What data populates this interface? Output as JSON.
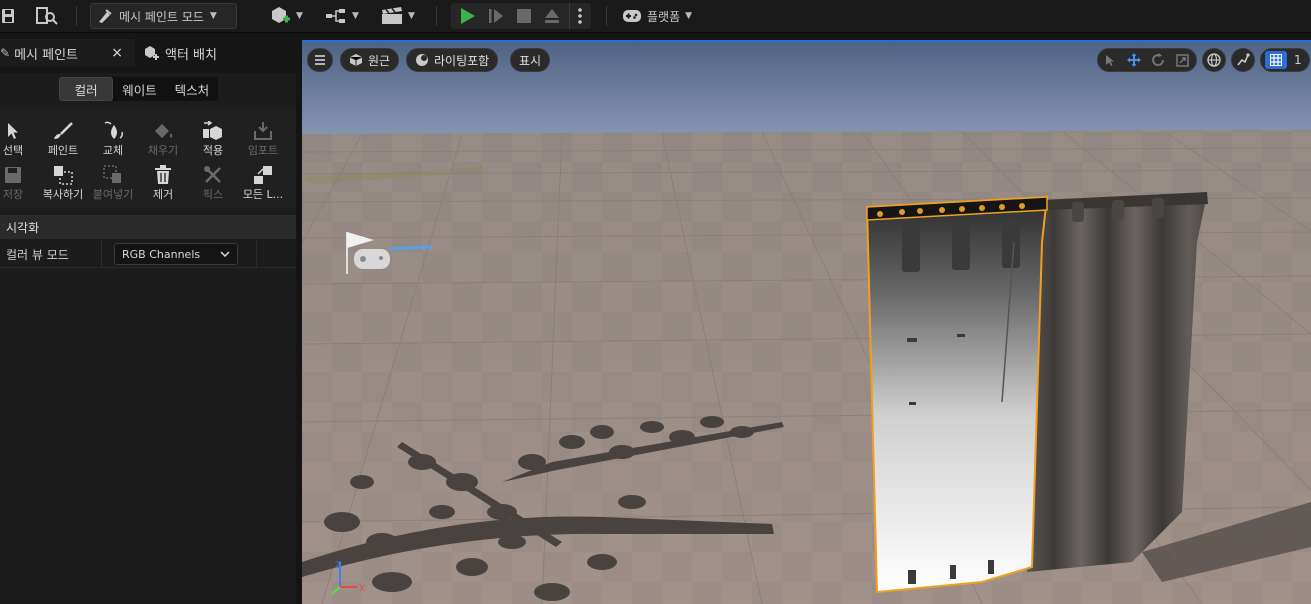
{
  "toolbar": {
    "mode_label": "메시 페인트 모드",
    "platform_label": "플랫폼",
    "icons": [
      "save-icon",
      "browse-icon",
      "mode-icon",
      "add-actor-icon",
      "blueprint-icon",
      "cinematics-icon",
      "play-icon",
      "step-icon",
      "stop-icon",
      "eject-icon",
      "more-icon",
      "platform-icon"
    ]
  },
  "left_panel": {
    "tabs": [
      {
        "label": "메시 페인트",
        "close": "×"
      },
      {
        "label": "액터 배치"
      }
    ],
    "subtabs": [
      "컬러",
      "웨이트",
      "텍스처"
    ],
    "active_subtab": "컬러",
    "tools": [
      {
        "label": "선택",
        "icon": "select-icon",
        "enabled": true
      },
      {
        "label": "페인트",
        "icon": "paint-brush-icon",
        "enabled": true
      },
      {
        "label": "교체",
        "icon": "swap-icon",
        "enabled": true
      },
      {
        "label": "채우기",
        "icon": "fill-icon",
        "enabled": false
      },
      {
        "label": "적용",
        "icon": "apply-icon",
        "enabled": true
      },
      {
        "label": "임포트",
        "icon": "import-icon",
        "enabled": false
      },
      {
        "label": "저장",
        "icon": "save-icon",
        "enabled": false
      },
      {
        "label": "복사하기",
        "icon": "copy-icon",
        "enabled": true
      },
      {
        "label": "붙여넣기",
        "icon": "paste-icon",
        "enabled": false
      },
      {
        "label": "제거",
        "icon": "trash-icon",
        "enabled": true
      },
      {
        "label": "픽스",
        "icon": "fix-icon",
        "enabled": false
      },
      {
        "label": "모든 L...",
        "icon": "lod-icon",
        "enabled": true
      }
    ],
    "section_title": "시각화",
    "properties": [
      {
        "label": "컬러 뷰 모드",
        "value": "RGB Channels"
      }
    ]
  },
  "viewport": {
    "pills": [
      {
        "label": "원근",
        "icon": "perspective-icon"
      },
      {
        "label": "라이팅포함",
        "icon": "lit-icon"
      },
      {
        "label": "표시",
        "icon": ""
      }
    ],
    "grid_value": "1",
    "axis_labels": {
      "x": "X",
      "z": "Z"
    },
    "colors": {
      "sky_top": "#55698a",
      "sky_bottom": "#8a9bb5",
      "floor": "#9a8c86",
      "selection": "#f0a020",
      "accent": "#2a6fd6"
    }
  }
}
